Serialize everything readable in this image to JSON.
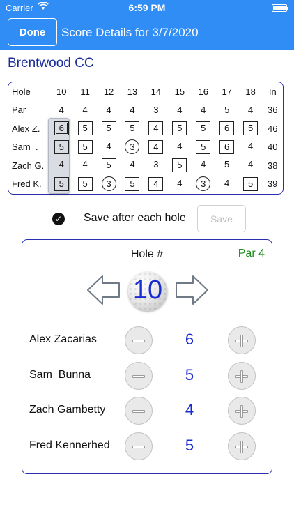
{
  "status": {
    "carrier": "Carrier",
    "time": "6:59 PM"
  },
  "nav": {
    "done_label": "Done",
    "title": "Score Details for 3/7/2020"
  },
  "course": "Brentwood CC",
  "scorecard": {
    "header": [
      "Hole",
      "10",
      "11",
      "12",
      "13",
      "14",
      "15",
      "16",
      "17",
      "18",
      "In"
    ],
    "par": [
      "Par",
      "4",
      "4",
      "4",
      "4",
      "3",
      "4",
      "4",
      "5",
      "4",
      "36"
    ],
    "players": [
      {
        "name": "Alex Z.",
        "scores": [
          "6",
          "5",
          "5",
          "5",
          "4",
          "5",
          "5",
          "6",
          "5"
        ],
        "styles": [
          "dbl",
          "box",
          "box",
          "box",
          "box",
          "box",
          "box",
          "box",
          "box"
        ],
        "total": "46"
      },
      {
        "name": "Sam  .",
        "scores": [
          "5",
          "5",
          "4",
          "3",
          "4",
          "4",
          "5",
          "6",
          "4"
        ],
        "styles": [
          "box",
          "box",
          "",
          "circ",
          "box",
          "",
          "box",
          "box",
          ""
        ],
        "total": "40"
      },
      {
        "name": "Zach G.",
        "scores": [
          "4",
          "4",
          "5",
          "4",
          "3",
          "5",
          "4",
          "5",
          "4"
        ],
        "styles": [
          "",
          "",
          "box",
          "",
          "",
          "box",
          "",
          "",
          ""
        ],
        "total": "38"
      },
      {
        "name": "Fred K.",
        "scores": [
          "5",
          "5",
          "3",
          "5",
          "4",
          "4",
          "3",
          "4",
          "5"
        ],
        "styles": [
          "box",
          "box",
          "circ",
          "box",
          "box",
          "",
          "circ",
          "",
          "box"
        ],
        "total": "39"
      }
    ]
  },
  "save": {
    "label": "Save after each hole",
    "button_label": "Save"
  },
  "hole": {
    "title": "Hole #",
    "par_label": "Par 4",
    "number": "10",
    "players": [
      {
        "name": "Alex Zacarias",
        "score": "6"
      },
      {
        "name": "Sam  Bunna",
        "score": "5"
      },
      {
        "name": "Zach Gambetty",
        "score": "4"
      },
      {
        "name": "Fred Kennerhed",
        "score": "5"
      }
    ]
  },
  "colors": {
    "nav_bg": "#2f8df5",
    "accent": "#1a2bd0",
    "border": "#2a2fb0",
    "par": "#1a8a1a"
  },
  "icons": [
    "wifi-icon",
    "battery-icon",
    "check-icon",
    "left-arrow-icon",
    "right-arrow-icon",
    "golf-ball-icon",
    "minus-icon",
    "plus-icon"
  ]
}
